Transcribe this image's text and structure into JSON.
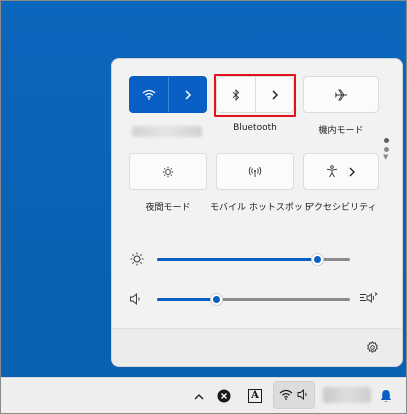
{
  "quick_settings": {
    "tiles": [
      {
        "id": "wifi",
        "label": "",
        "icon": "wifi-icon",
        "state": "on"
      },
      {
        "id": "bluetooth",
        "label": "Bluetooth",
        "icon": "bluetooth-icon",
        "state": "off"
      },
      {
        "id": "airplane",
        "label": "機内モード",
        "icon": "airplane-icon",
        "state": "off"
      },
      {
        "id": "night_light",
        "label": "夜間モード",
        "icon": "night-light-icon",
        "state": "off"
      },
      {
        "id": "hotspot",
        "label": "モバイル ホットスポット",
        "icon": "hotspot-icon",
        "state": "off"
      },
      {
        "id": "accessibility",
        "label": "アクセシビリティ",
        "icon": "accessibility-icon",
        "state": "off"
      }
    ],
    "brightness": {
      "icon": "brightness-icon",
      "level": 0.83
    },
    "volume": {
      "icon": "speaker-icon",
      "level": 0.31,
      "output_icon": "audio-output-icon"
    },
    "settings_icon": "gear-icon",
    "pages": {
      "count": 2,
      "current": 1
    },
    "highlight_target": "bluetooth"
  },
  "taskbar": {
    "tray": [
      {
        "id": "show_hidden",
        "icon": "chevron-up-icon"
      },
      {
        "id": "app_x",
        "icon": "close-circle-icon"
      },
      {
        "id": "ime",
        "icon": "ime-icon",
        "text": "A"
      },
      {
        "id": "network_volume",
        "icon": "wifi-speaker-icon"
      },
      {
        "id": "notifications",
        "icon": "bell-icon"
      }
    ]
  },
  "colors": {
    "accent": "#0a5fc4",
    "desktop": "#0a63b8",
    "highlight": "#e0121c",
    "panel": "#f2f2f2"
  }
}
